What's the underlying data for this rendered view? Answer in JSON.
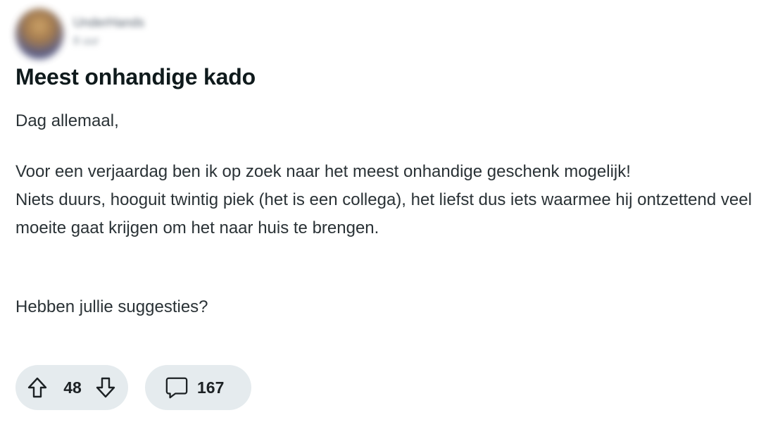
{
  "post": {
    "author": {
      "name": "UnderHands",
      "meta": "8 uur"
    },
    "title": "Meest onhandige kado",
    "body": {
      "greeting": "Dag allemaal,",
      "paragraph": "Voor een verjaardag ben ik op zoek naar het meest onhandige geschenk mogelijk!",
      "paragraph_line2": "Niets duurs, hooguit twintig piek (het is een collega), het liefst dus iets waarmee hij ontzettend veel moeite gaat krijgen om het naar huis te brengen.",
      "question": "Hebben jullie suggesties?"
    },
    "actions": {
      "vote_count": "48",
      "comment_count": "167",
      "icons": {
        "upvote": "arrow-up-icon",
        "downvote": "arrow-down-icon",
        "comments": "speech-bubble-icon"
      }
    }
  },
  "colors": {
    "pill_background": "#e5ebee",
    "title_text": "#0f1a1c",
    "body_text": "#2a3236"
  }
}
